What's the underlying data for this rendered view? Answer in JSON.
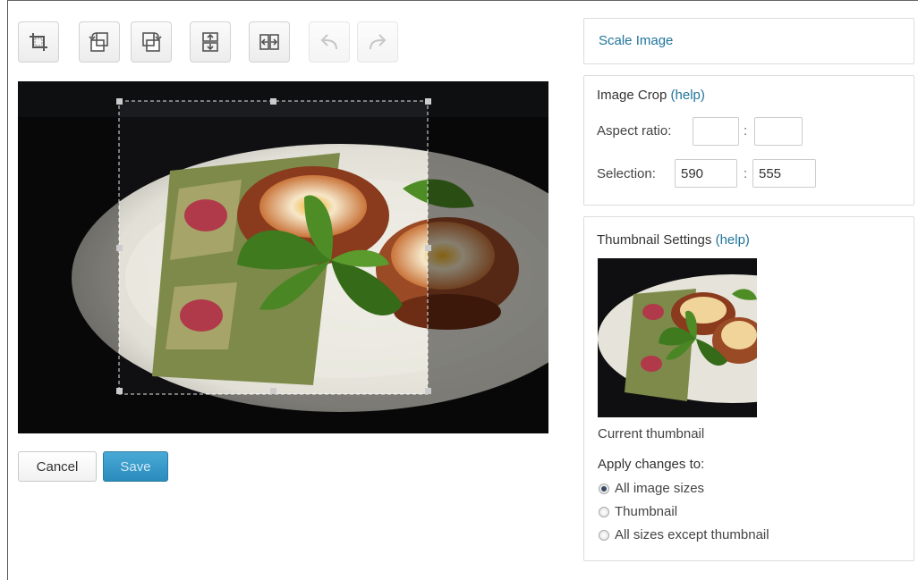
{
  "toolbar": {
    "buttons": [
      {
        "icon": "crop-icon",
        "enabled": true
      },
      {
        "icon": "rotate-left-icon",
        "enabled": true
      },
      {
        "icon": "rotate-right-icon",
        "enabled": true
      },
      {
        "icon": "flip-vertical-icon",
        "enabled": true
      },
      {
        "icon": "flip-horizontal-icon",
        "enabled": true
      },
      {
        "icon": "undo-icon",
        "enabled": false
      },
      {
        "icon": "redo-icon",
        "enabled": false
      }
    ]
  },
  "actions": {
    "cancel_label": "Cancel",
    "save_label": "Save"
  },
  "scale": {
    "title": "Scale Image"
  },
  "crop": {
    "title": "Image Crop",
    "help": "(help)",
    "aspect_label": "Aspect ratio:",
    "aspect_w": "",
    "aspect_h": "",
    "separator": ":",
    "selection_label": "Selection:",
    "selection_w": "590",
    "selection_h": "555"
  },
  "thumbnail": {
    "title": "Thumbnail Settings",
    "help": "(help)",
    "caption": "Current thumbnail",
    "apply_label": "Apply changes to:",
    "options": [
      {
        "label": "All image sizes",
        "checked": true
      },
      {
        "label": "Thumbnail",
        "checked": false
      },
      {
        "label": "All sizes except thumbnail",
        "checked": false
      }
    ]
  },
  "colors": {
    "accent": "#21759b",
    "save_bg": "#2a8bbd"
  }
}
